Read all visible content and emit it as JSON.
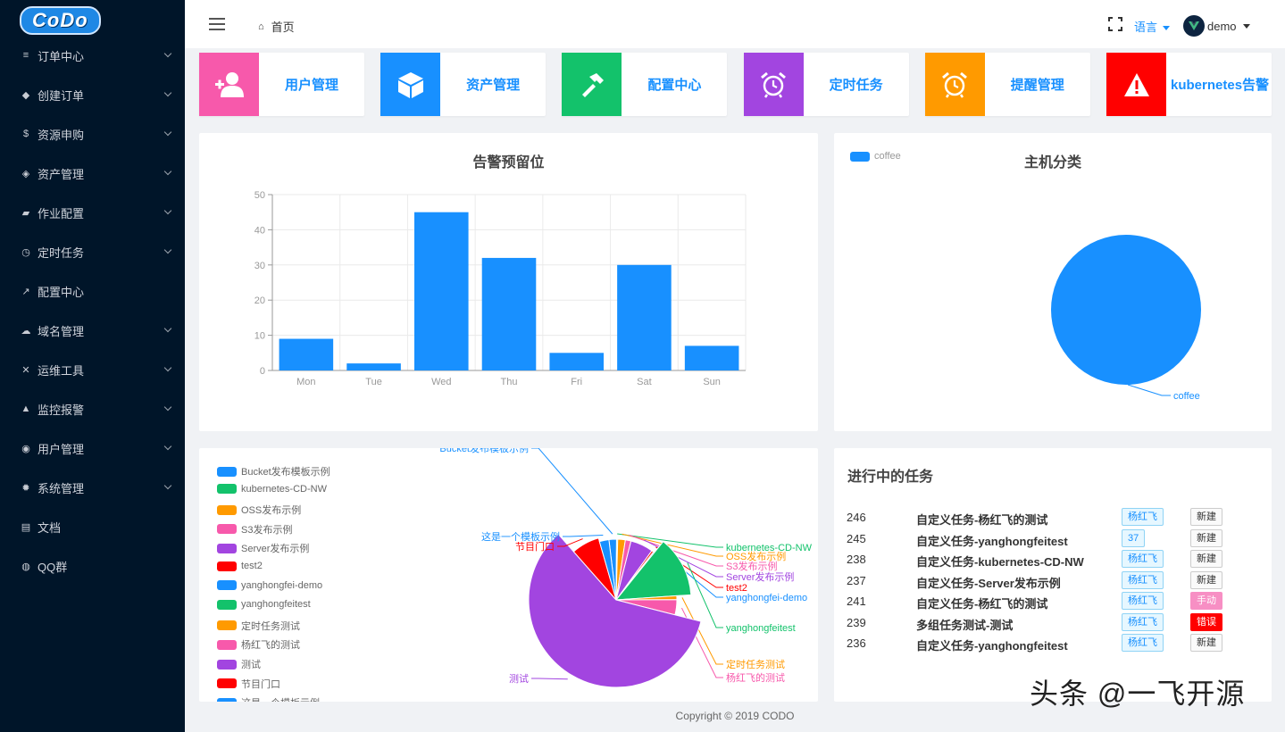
{
  "app": {
    "logo_text": "CoDo"
  },
  "sidebar": {
    "items": [
      {
        "label": "订单中心",
        "icon": "list-icon",
        "glyph": "≡",
        "has_children": true
      },
      {
        "label": "创建订单",
        "icon": "shield-icon",
        "glyph": "◆",
        "has_children": true
      },
      {
        "label": "资源申购",
        "icon": "dollar-icon",
        "glyph": "$",
        "has_children": true
      },
      {
        "label": "资产管理",
        "icon": "cube-icon",
        "glyph": "◈",
        "has_children": true
      },
      {
        "label": "作业配置",
        "icon": "car-icon",
        "glyph": "▰",
        "has_children": true
      },
      {
        "label": "定时任务",
        "icon": "alarm-icon",
        "glyph": "◷",
        "has_children": true
      },
      {
        "label": "配置中心",
        "icon": "hammer-icon",
        "glyph": "↗",
        "has_children": false
      },
      {
        "label": "域名管理",
        "icon": "cloud-icon",
        "glyph": "☁",
        "has_children": true
      },
      {
        "label": "运维工具",
        "icon": "tools-icon",
        "glyph": "✕",
        "has_children": true
      },
      {
        "label": "监控报警",
        "icon": "bell-icon",
        "glyph": "▲",
        "has_children": true
      },
      {
        "label": "用户管理",
        "icon": "users-icon",
        "glyph": "◉",
        "has_children": true
      },
      {
        "label": "系统管理",
        "icon": "gear-icon",
        "glyph": "✹",
        "has_children": true
      },
      {
        "label": "文档",
        "icon": "book-icon",
        "glyph": "▤",
        "has_children": false
      },
      {
        "label": "QQ群",
        "icon": "qq-icon",
        "glyph": "◍",
        "has_children": false
      }
    ]
  },
  "header": {
    "breadcrumb_home": "首页",
    "language_label": "语言",
    "username": "demo"
  },
  "quick_cards": [
    {
      "label": "用户管理",
      "color": "#f759ab",
      "icon": "user-add-icon"
    },
    {
      "label": "资产管理",
      "color": "#1890ff",
      "icon": "cube-icon"
    },
    {
      "label": "配置中心",
      "color": "#13c26b",
      "icon": "hammer-icon"
    },
    {
      "label": "定时任务",
      "color": "#a245e0",
      "icon": "alarm-clock-icon"
    },
    {
      "label": "提醒管理",
      "color": "#ff9a00",
      "icon": "alarm-clock-icon"
    },
    {
      "label": "kubernetes告警",
      "color": "#ff0000",
      "icon": "warning-icon"
    }
  ],
  "alert_chart": {
    "title": "告警预留位"
  },
  "host_chart": {
    "title": "主机分类",
    "legend_label": "coffee"
  },
  "task_pie": {
    "legend": [
      {
        "label": "Bucket发布模板示例",
        "color": "#1890ff"
      },
      {
        "label": "kubernetes-CD-NW",
        "color": "#13c26b"
      },
      {
        "label": "OSS发布示例",
        "color": "#ff9a00"
      },
      {
        "label": "S3发布示例",
        "color": "#f759ab"
      },
      {
        "label": "Server发布示例",
        "color": "#a245e0"
      },
      {
        "label": "test2",
        "color": "#ff0000"
      },
      {
        "label": "yanghongfei-demo",
        "color": "#1890ff"
      },
      {
        "label": "yanghongfeitest",
        "color": "#13c26b"
      },
      {
        "label": "定时任务测试",
        "color": "#ff9a00"
      },
      {
        "label": "杨红飞的测试",
        "color": "#f759ab"
      },
      {
        "label": "测试",
        "color": "#a245e0"
      },
      {
        "label": "节目门口",
        "color": "#ff0000"
      },
      {
        "label": "这是一个模板示例",
        "color": "#1890ff"
      }
    ]
  },
  "tasks": {
    "title": "进行中的任务",
    "rows": [
      {
        "id": "246",
        "name": "自定义任务-杨红飞的测试",
        "user": "杨红飞",
        "status": "新建",
        "status_type": "new"
      },
      {
        "id": "245",
        "name": "自定义任务-yanghongfeitest",
        "user": "37",
        "status": "新建",
        "status_type": "new"
      },
      {
        "id": "238",
        "name": "自定义任务-kubernetes-CD-NW",
        "user": "杨红飞",
        "status": "新建",
        "status_type": "new"
      },
      {
        "id": "237",
        "name": "自定义任务-Server发布示例",
        "user": "杨红飞",
        "status": "新建",
        "status_type": "new"
      },
      {
        "id": "241",
        "name": "自定义任务-杨红飞的测试",
        "user": "杨红飞",
        "status": "手动",
        "status_type": "manual"
      },
      {
        "id": "239",
        "name": "多组任务测试-测试",
        "user": "杨红飞",
        "status": "错误",
        "status_type": "error"
      },
      {
        "id": "236",
        "name": "自定义任务-yanghongfeitest",
        "user": "杨红飞",
        "status": "新建",
        "status_type": "new"
      }
    ]
  },
  "footer": {
    "copyright": "Copyright © 2019 CODO"
  },
  "watermark": "头条 @一飞开源",
  "chart_data": [
    {
      "type": "bar",
      "title": "告警预留位",
      "categories": [
        "Mon",
        "Tue",
        "Wed",
        "Thu",
        "Fri",
        "Sat",
        "Sun"
      ],
      "values": [
        9,
        2,
        45,
        32,
        5,
        30,
        7
      ],
      "ylim": [
        0,
        50
      ],
      "yticks": [
        0,
        10,
        20,
        30,
        40,
        50
      ],
      "color": "#1890ff",
      "grid": true
    },
    {
      "type": "pie",
      "title": "主机分类",
      "labels": [
        "coffee"
      ],
      "values": [
        1
      ],
      "colors": [
        "#1890ff"
      ],
      "legend_position": "top-left"
    },
    {
      "type": "pie",
      "labels": [
        "Bucket发布模板示例",
        "kubernetes-CD-NW",
        "OSS发布示例",
        "S3发布示例",
        "Server发布示例",
        "test2",
        "yanghongfei-demo",
        "yanghongfeitest",
        "定时任务测试",
        "杨红飞的测试",
        "测试",
        "节目门口",
        "这是一个模板示例"
      ],
      "values": [
        2,
        0.3,
        2,
        1.5,
        6,
        0.5,
        0.3,
        13,
        1,
        4,
        59,
        7,
        2.5
      ],
      "colors": [
        "#1890ff",
        "#13c26b",
        "#ff9a00",
        "#f759ab",
        "#a245e0",
        "#ff0000",
        "#1890ff",
        "#13c26b",
        "#ff9a00",
        "#f759ab",
        "#a245e0",
        "#ff0000",
        "#1890ff"
      ],
      "legend_position": "left"
    }
  ]
}
